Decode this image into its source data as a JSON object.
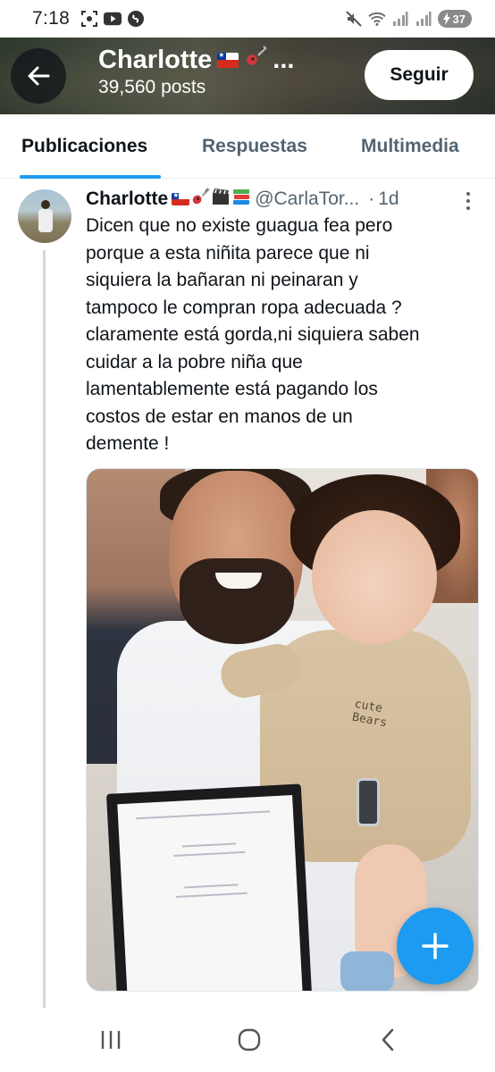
{
  "status_bar": {
    "time": "7:18",
    "battery": "37",
    "icons": [
      "screenshot-icon",
      "youtube-icon",
      "shazam-icon",
      "mute-icon",
      "wifi-icon",
      "signal-icon",
      "signal-icon",
      "battery-icon"
    ]
  },
  "header": {
    "name": "Charlotte",
    "name_suffix": "...",
    "posts": "39,560 posts",
    "follow_label": "Seguir",
    "banner_color": "#4f584a"
  },
  "tabs": [
    {
      "label": "Publicaciones",
      "active": true
    },
    {
      "label": "Respuestas",
      "active": false
    },
    {
      "label": "Multimedia",
      "active": false
    }
  ],
  "tweet": {
    "author": "Charlotte",
    "handle": "@CarlaTor...",
    "separator": "·",
    "time": "1d",
    "text": "Dicen que no existe guagua fea pero porque a esta niñita parece que ni siquiera la bañaran ni peinaran y tampoco le compran ropa adecuada ? claramente está gorda,ni siquiera saben cuidar a la pobre niña que lamentablemente está pagando los costos de estar en manos de un demente !",
    "text_lines": [
      "Dicen que no existe guagua fea pero",
      "porque a esta niñita parece que ni",
      "siquiera la bañaran ni peinaran y",
      "tampoco le compran ropa adecuada ?",
      "claramente está gorda,ni siquiera saben",
      "cuidar a la pobre niña que",
      "lamentablemente está pagando los",
      "costos de estar en manos de un",
      "demente !"
    ],
    "photo_shirt_text": "cute Bears"
  },
  "colors": {
    "accent": "#1d9bf0",
    "text_primary": "#0f1419",
    "text_secondary": "#536471"
  }
}
